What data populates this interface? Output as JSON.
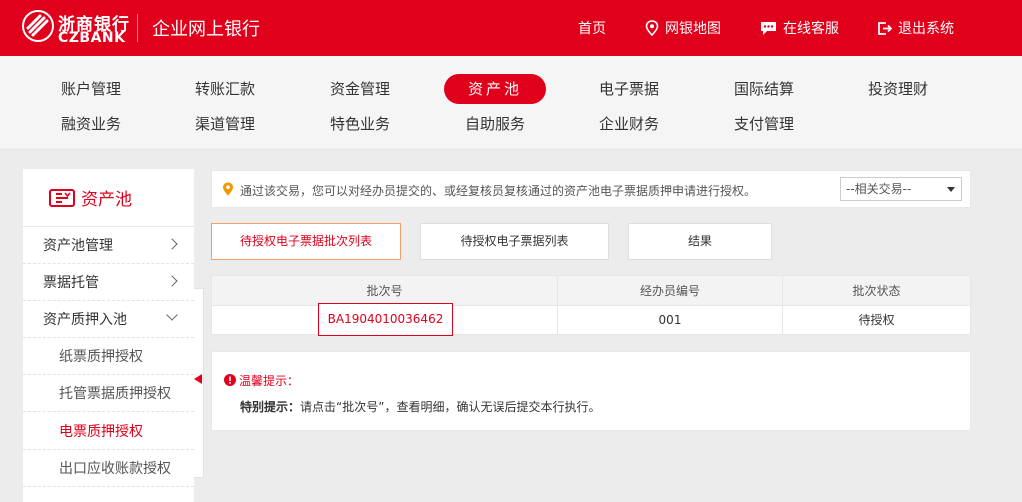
{
  "header": {
    "brand_cn": "浙商银行",
    "brand_en": "CZBANK",
    "title": "企业网上银行",
    "links": [
      {
        "label": "首页",
        "icon": ""
      },
      {
        "label": "网银地图",
        "icon": "map-pin-icon"
      },
      {
        "label": "在线客服",
        "icon": "chat-icon"
      },
      {
        "label": "退出系统",
        "icon": "logout-icon"
      }
    ]
  },
  "nav": {
    "row1": [
      "账户管理",
      "转账汇款",
      "资金管理",
      "资产池",
      "电子票据",
      "国际结算",
      "投资理财"
    ],
    "row2": [
      "融资业务",
      "渠道管理",
      "特色业务",
      "自助服务",
      "企业财务",
      "支付管理"
    ],
    "active": "资产池"
  },
  "sidebar": {
    "title": "资产池",
    "items": [
      {
        "label": "资产池管理",
        "level": 1,
        "chevron": "right"
      },
      {
        "label": "票据托管",
        "level": 1,
        "chevron": "right"
      },
      {
        "label": "资产质押入池",
        "level": 1,
        "chevron": "down"
      },
      {
        "label": "纸票质押授权",
        "level": 2
      },
      {
        "label": "托管票据质押授权",
        "level": 2
      },
      {
        "label": "电票质押授权",
        "level": 2,
        "current": true
      },
      {
        "label": "出口应收账款授权",
        "level": 2
      }
    ]
  },
  "notice": {
    "text": "通过该交易，您可以对经办员提交的、或经复核员复核通过的资产池电子票据质押申请进行授权。",
    "select_value": "--相关交易--"
  },
  "tabs": [
    "待授权电子票据批次列表",
    "待授权电子票据列表",
    "结果"
  ],
  "table": {
    "headers": [
      "批次号",
      "经办员编号",
      "批次状态"
    ],
    "rows": [
      [
        "BA1904010036462",
        "001",
        "待授权"
      ]
    ]
  },
  "tips": {
    "title": "温馨提示：",
    "label": "特别提示：",
    "body": "请点击“批次号”，查看明细，确认无误后提交本行执行。"
  },
  "colors": {
    "brand": "#e0001b",
    "background": "#ececec"
  }
}
